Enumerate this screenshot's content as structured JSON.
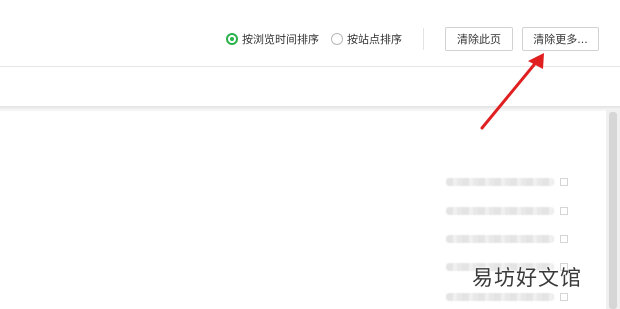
{
  "toolbar": {
    "sort_options": [
      {
        "label": "按浏览时间排序",
        "checked": true
      },
      {
        "label": "按站点排序",
        "checked": false
      }
    ],
    "clear_page_label": "清除此页",
    "clear_more_label": "清除更多...",
    "accent_color": "#2bb24c"
  },
  "annotation": {
    "arrow_color": "#e02020",
    "target": "clear_more_button"
  },
  "list": {
    "rows": 5,
    "content": "blurred"
  },
  "watermark": "易坊好文馆"
}
